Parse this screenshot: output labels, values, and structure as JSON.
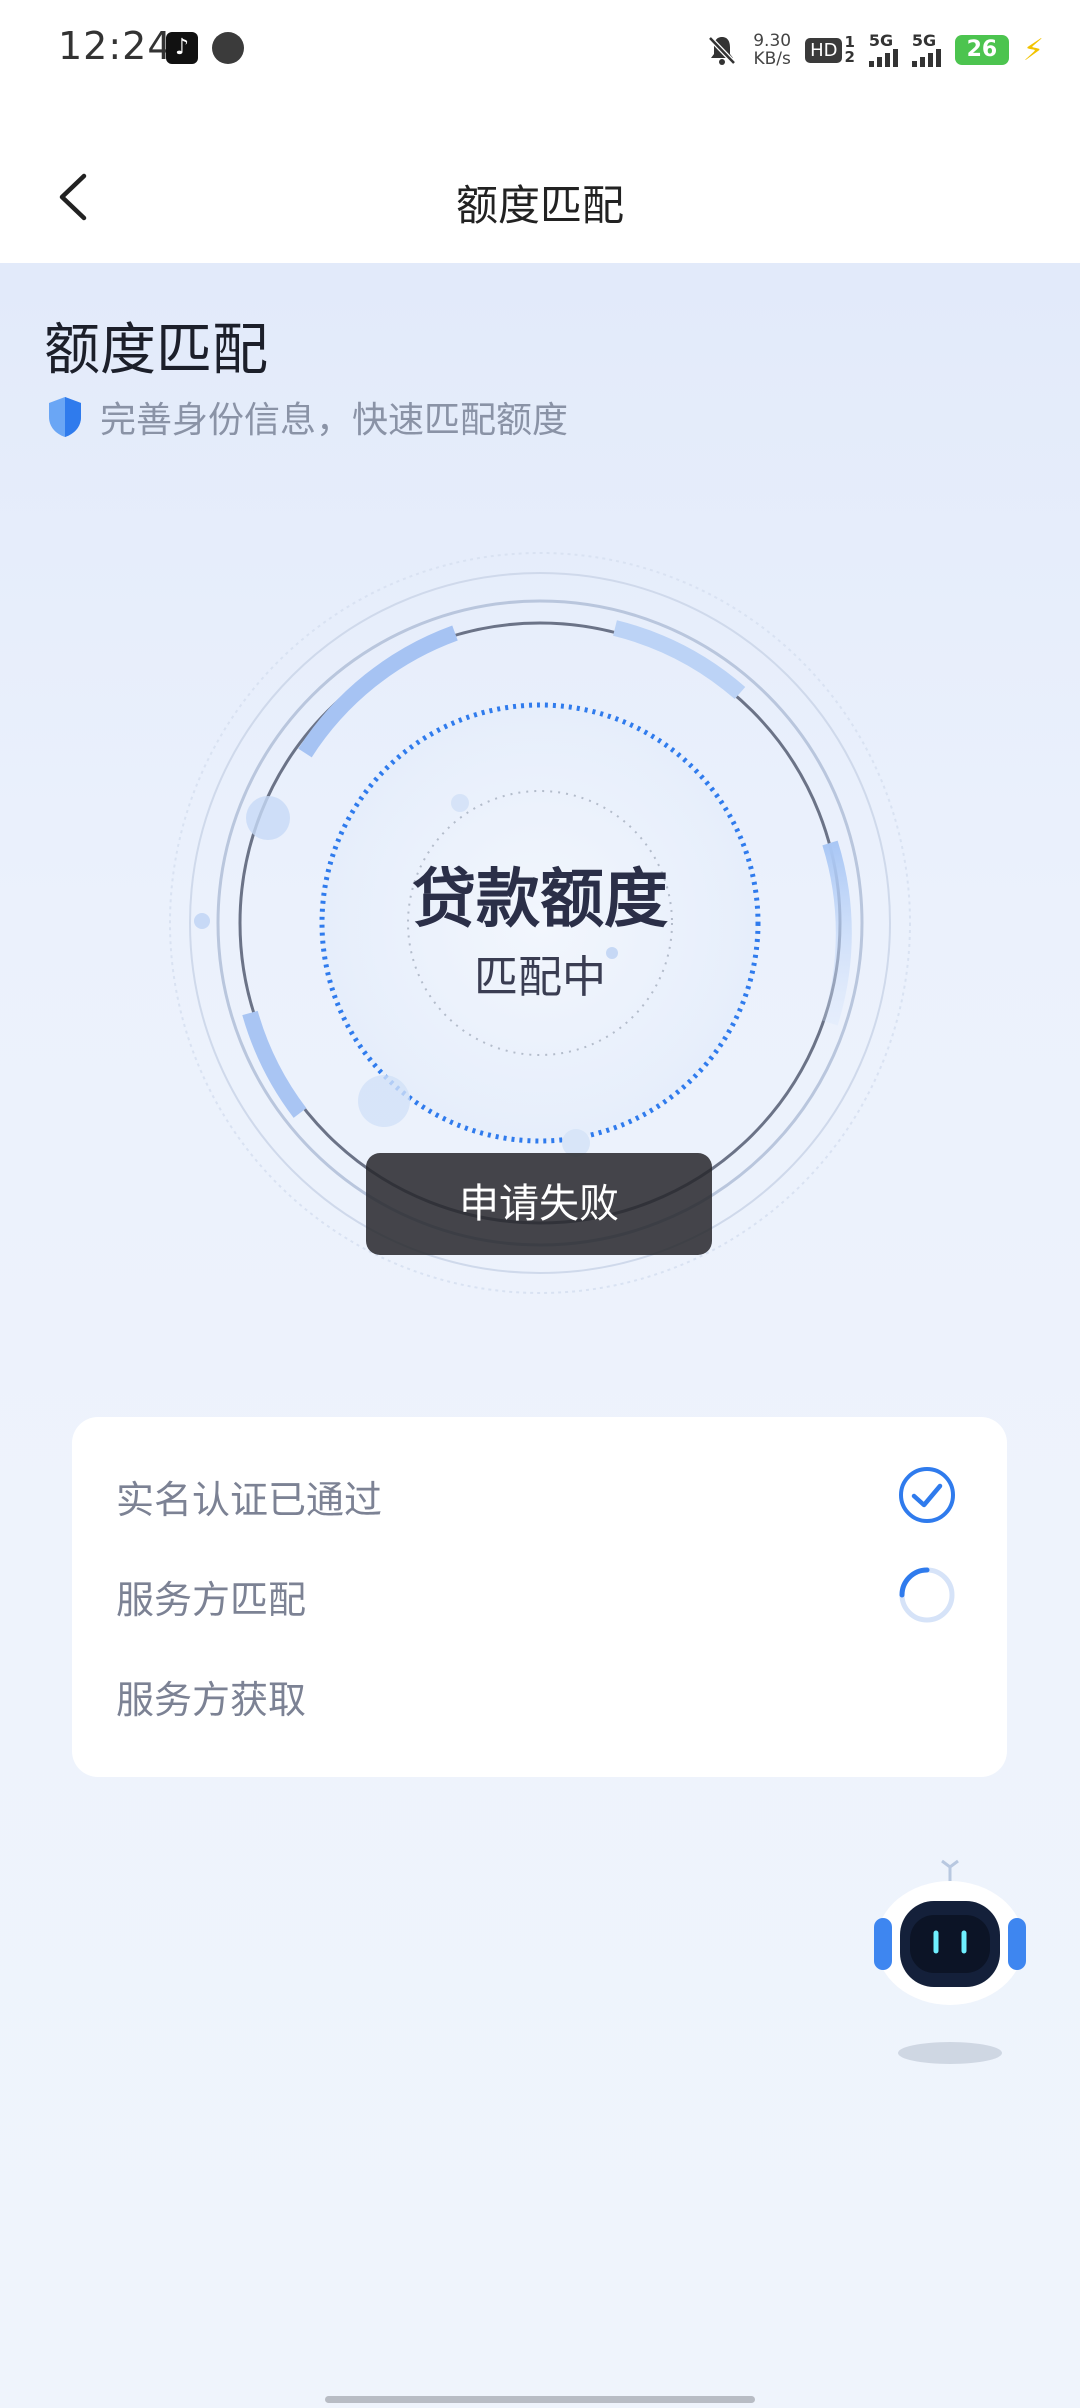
{
  "status_bar": {
    "time": "12:24",
    "net_speed_value": "9.30",
    "net_speed_unit": "KB/s",
    "hd_badge": "HD",
    "hd_sim_top": "1",
    "hd_sim_bottom": "2",
    "signal1_label": "5G",
    "signal2_label": "5G",
    "battery_level": "26"
  },
  "nav": {
    "title": "额度匹配"
  },
  "header": {
    "title": "额度匹配",
    "subtitle": "完善身份信息，快速匹配额度"
  },
  "radar": {
    "title": "贷款额度",
    "status": "匹配中"
  },
  "toast": {
    "message": "申请失败"
  },
  "steps": {
    "items": [
      {
        "label": "实名认证已通过",
        "state": "done"
      },
      {
        "label": "服务方匹配",
        "state": "loading"
      },
      {
        "label": "服务方获取",
        "state": "pending"
      }
    ]
  },
  "colors": {
    "accent": "#2f7bed",
    "background_top": "#e2eafa",
    "card": "#ffffff",
    "toast": "#2f2f33"
  }
}
